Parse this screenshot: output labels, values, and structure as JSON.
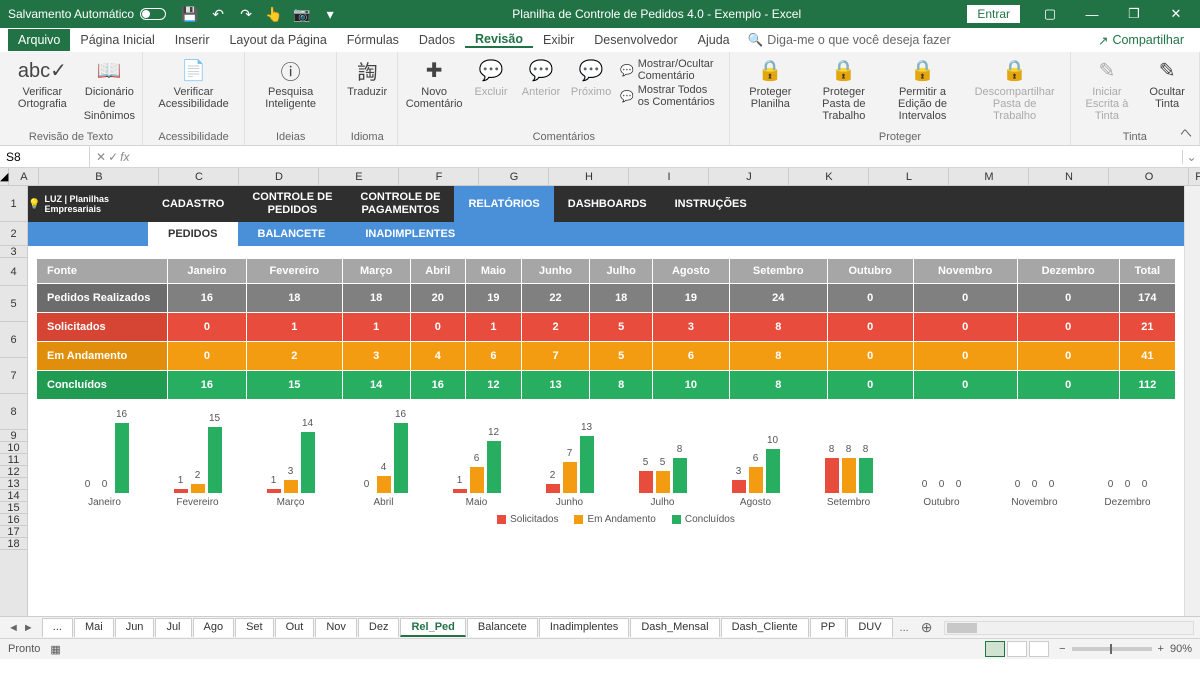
{
  "titlebar": {
    "autosave": "Salvamento Automático",
    "title": "Planilha de Controle de Pedidos 4.0 - Exemplo  -  Excel",
    "signin": "Entrar"
  },
  "menu": {
    "file": "Arquivo",
    "tabs": [
      "Página Inicial",
      "Inserir",
      "Layout da Página",
      "Fórmulas",
      "Dados",
      "Revisão",
      "Exibir",
      "Desenvolvedor",
      "Ajuda"
    ],
    "active": "Revisão",
    "tellme": "Diga-me o que você deseja fazer",
    "share": "Compartilhar"
  },
  "ribbon": {
    "groups": {
      "revisao_texto": {
        "label": "Revisão de Texto",
        "items": [
          {
            "icon": "abc✓",
            "label": "Verificar Ortografia"
          },
          {
            "icon": "📖",
            "label": "Dicionário de Sinônimos"
          }
        ]
      },
      "acessibilidade": {
        "label": "Acessibilidade",
        "items": [
          {
            "icon": "📄",
            "label": "Verificar Acessibilidade"
          }
        ]
      },
      "ideias": {
        "label": "Ideias",
        "items": [
          {
            "icon": "ⓘ",
            "label": "Pesquisa Inteligente"
          }
        ]
      },
      "idioma": {
        "label": "Idioma",
        "items": [
          {
            "icon": "䛬",
            "label": "Traduzir"
          }
        ]
      },
      "comentarios": {
        "label": "Comentários",
        "items": [
          {
            "icon": "✚",
            "label": "Novo Comentário"
          },
          {
            "icon": "💬",
            "label": "Excluir",
            "disabled": true
          },
          {
            "icon": "💬",
            "label": "Anterior",
            "disabled": true
          },
          {
            "icon": "💬",
            "label": "Próximo",
            "disabled": true
          }
        ],
        "opts": [
          "Mostrar/Ocultar Comentário",
          "Mostrar Todos os Comentários"
        ]
      },
      "proteger": {
        "label": "Proteger",
        "items": [
          {
            "icon": "🔒",
            "label": "Proteger Planilha"
          },
          {
            "icon": "🔒",
            "label": "Proteger Pasta de Trabalho"
          },
          {
            "icon": "🔒",
            "label": "Permitir a Edição de Intervalos"
          },
          {
            "icon": "🔒",
            "label": "Descompartilhar Pasta de Trabalho",
            "disabled": true
          }
        ]
      },
      "tinta": {
        "label": "Tinta",
        "items": [
          {
            "icon": "✎",
            "label": "Iniciar Escrita à Tinta",
            "disabled": true
          },
          {
            "icon": "✎",
            "label": "Ocultar Tinta"
          }
        ]
      }
    }
  },
  "fxbar": {
    "namebox": "S8",
    "formula": ""
  },
  "columns": [
    "A",
    "B",
    "C",
    "D",
    "E",
    "F",
    "G",
    "H",
    "I",
    "J",
    "K",
    "L",
    "M",
    "N",
    "O",
    "P"
  ],
  "rows_left": [
    1,
    2,
    3,
    4,
    5,
    6,
    7,
    8,
    9,
    10,
    11,
    12,
    13,
    14,
    15,
    16,
    17,
    18
  ],
  "dashboard": {
    "logo": "LUZ | Planilhas Empresariais",
    "tabs": [
      "CADASTRO",
      "CONTROLE DE PEDIDOS",
      "CONTROLE DE PAGAMENTOS",
      "RELATÓRIOS",
      "DASHBOARDS",
      "INSTRUÇÕES"
    ],
    "active_tab": "RELATÓRIOS",
    "subtabs": [
      "PEDIDOS",
      "BALANCETE",
      "INADIMPLENTES"
    ],
    "active_sub": "PEDIDOS"
  },
  "table": {
    "months": [
      "Janeiro",
      "Fevereiro",
      "Março",
      "Abril",
      "Maio",
      "Junho",
      "Julho",
      "Agosto",
      "Setembro",
      "Outubro",
      "Novembro",
      "Dezembro"
    ],
    "header_first": "Fonte",
    "header_total": "Total",
    "rows": [
      {
        "label": "Pedidos Realizados",
        "vals": [
          16,
          18,
          18,
          20,
          19,
          22,
          18,
          19,
          24,
          0,
          0,
          0
        ],
        "total": 174,
        "class": "r-realizados"
      },
      {
        "label": "Solicitados",
        "vals": [
          0,
          1,
          1,
          0,
          1,
          2,
          5,
          3,
          8,
          0,
          0,
          0
        ],
        "total": 21,
        "class": "r-solicitados"
      },
      {
        "label": "Em Andamento",
        "vals": [
          0,
          2,
          3,
          4,
          6,
          7,
          5,
          6,
          8,
          0,
          0,
          0
        ],
        "total": 41,
        "class": "r-andamento"
      },
      {
        "label": "Concluídos",
        "vals": [
          16,
          15,
          14,
          16,
          12,
          13,
          8,
          10,
          8,
          0,
          0,
          0
        ],
        "total": 112,
        "class": "r-concluidos"
      }
    ]
  },
  "chart_data": {
    "type": "bar",
    "categories": [
      "Janeiro",
      "Fevereiro",
      "Março",
      "Abril",
      "Maio",
      "Junho",
      "Julho",
      "Agosto",
      "Setembro",
      "Outubro",
      "Novembro",
      "Dezembro"
    ],
    "series": [
      {
        "name": "Solicitados",
        "color": "#e84c3d",
        "values": [
          0,
          1,
          1,
          0,
          1,
          2,
          5,
          3,
          8,
          0,
          0,
          0
        ]
      },
      {
        "name": "Em Andamento",
        "color": "#f39c12",
        "values": [
          0,
          2,
          3,
          4,
          6,
          7,
          5,
          6,
          8,
          0,
          0,
          0
        ]
      },
      {
        "name": "Concluídos",
        "color": "#27ae60",
        "values": [
          16,
          15,
          14,
          16,
          12,
          13,
          8,
          10,
          8,
          0,
          0,
          0
        ]
      }
    ],
    "ylim": [
      0,
      16
    ]
  },
  "sheettabs": {
    "visible": [
      "...",
      "Mai",
      "Jun",
      "Jul",
      "Ago",
      "Set",
      "Out",
      "Nov",
      "Dez",
      "Rel_Ped",
      "Balancete",
      "Inadimplentes",
      "Dash_Mensal",
      "Dash_Cliente",
      "PP",
      "DUV"
    ],
    "active": "Rel_Ped",
    "more": "..."
  },
  "status": {
    "ready": "Pronto",
    "zoom": "90%"
  }
}
